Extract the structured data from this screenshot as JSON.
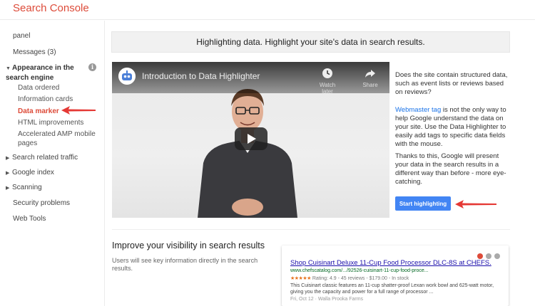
{
  "app": {
    "title": "Search Console"
  },
  "sidebar": {
    "items": [
      {
        "label": "panel"
      },
      {
        "label": "Messages (3)"
      },
      {
        "label": "Appearance in the search engine"
      },
      {
        "label": "Data ordered"
      },
      {
        "label": "Information cards"
      },
      {
        "label": "Data marker"
      },
      {
        "label": "HTML improvements"
      },
      {
        "label": "Accelerated AMP mobile pages"
      },
      {
        "label": "Search related traffic"
      },
      {
        "label": "Google index"
      },
      {
        "label": "Scanning"
      },
      {
        "label": "Security problems"
      },
      {
        "label": "Web Tools"
      }
    ],
    "info_glyph": "i"
  },
  "main": {
    "banner": "Highlighting data. Highlight your site's data in search results.",
    "video": {
      "title": "Introduction to Data Highlighter",
      "watch_later": "Watch later",
      "share": "Share"
    },
    "description": {
      "p1": "Does the site contain structured data, such as event lists or reviews based on reviews?",
      "p2_link": "Webmaster tag",
      "p2_rest": " is not the only way to help Google understand the data on your site. Use the Data Highlighter to easily add tags to specific data fields with the mouse.",
      "p3": "Thanks to this, Google will present your data in the search results in a different way than before - more eye-catching."
    },
    "start_button": "Start highlighting",
    "visibility": {
      "title": "Improve your visibility in search results",
      "subtitle": "Users will see key information directly in the search results."
    },
    "serp_example": {
      "title": "Shop Cuisinart Deluxe 11-Cup Food Processor DLC-8S at CHEFS.",
      "url": "www.chefscatalog.com/.../92526-cuisinart-11-cup-food-proce...",
      "stars": "★★★★★",
      "rating": " Rating: 4.9 - 45 reviews - $179.00 - In stock",
      "snippet": "This Cuisinart classic features an 11-cup shatter-proof Lexan work bowl and 625-watt motor, giving you the capacity and power for a full range of processor ...",
      "date": "Fri, Oct 12 · Walla Prooka Farms"
    }
  },
  "colors": {
    "brand": "#dd4b39",
    "primary": "#4285f4",
    "link": "#1a73e8",
    "annotation_arrow": "#e53935"
  }
}
